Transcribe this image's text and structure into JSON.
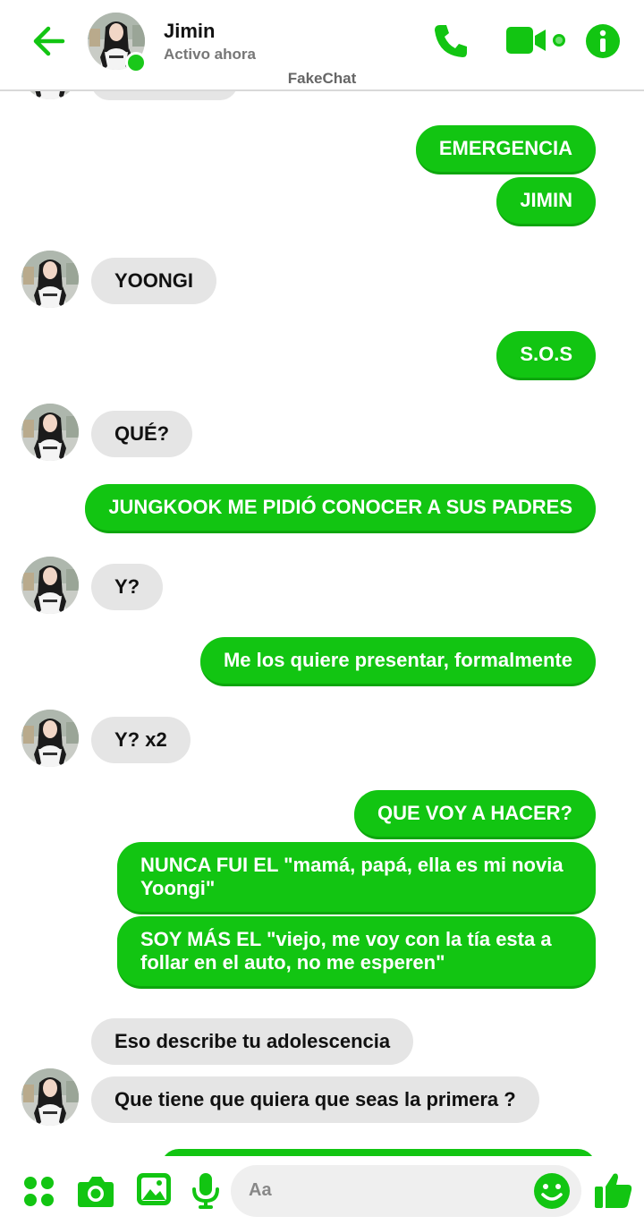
{
  "header": {
    "contact_name": "Jimin",
    "status": "Activo ahora",
    "app_label": "FakeChat"
  },
  "icons": {
    "back": "arrow-left-icon",
    "call": "phone-icon",
    "video": "video-camera-icon",
    "info": "info-icon",
    "apps": "apps-grid-icon",
    "camera": "camera-icon",
    "gallery": "image-icon",
    "mic": "microphone-icon",
    "emoji": "smiley-icon",
    "like": "thumbs-up-icon"
  },
  "colors": {
    "accent": "#12c512",
    "incoming_bubble": "#e5e5e5"
  },
  "messages": [
    {
      "dir": "out",
      "text": "EMERGENCIA"
    },
    {
      "dir": "out",
      "text": "JIMIN"
    },
    {
      "dir": "in",
      "text": "YOONGI"
    },
    {
      "dir": "out",
      "text": "S.O.S"
    },
    {
      "dir": "in",
      "text": "QUÉ?"
    },
    {
      "dir": "out",
      "text": "JUNGKOOK ME PIDIÓ CONOCER A SUS PADRES"
    },
    {
      "dir": "in",
      "text": "Y?"
    },
    {
      "dir": "out",
      "text": "Me los quiere presentar, formalmente"
    },
    {
      "dir": "in",
      "text": "Y? x2"
    },
    {
      "dir": "out",
      "text": "QUE VOY A HACER?"
    },
    {
      "dir": "out",
      "text": "NUNCA FUI EL \"mamá, papá, ella es mi novia Yoongi\""
    },
    {
      "dir": "out",
      "text": "SOY MÁS EL \"viejo, me voy con la tía esta a follar en el auto, no me esperen\""
    },
    {
      "dir": "in",
      "text": "Eso describe tu adolescencia"
    },
    {
      "dir": "in",
      "text": "Que tiene que quiera que seas la primera ?"
    }
  ],
  "composer": {
    "placeholder": "Aa"
  }
}
